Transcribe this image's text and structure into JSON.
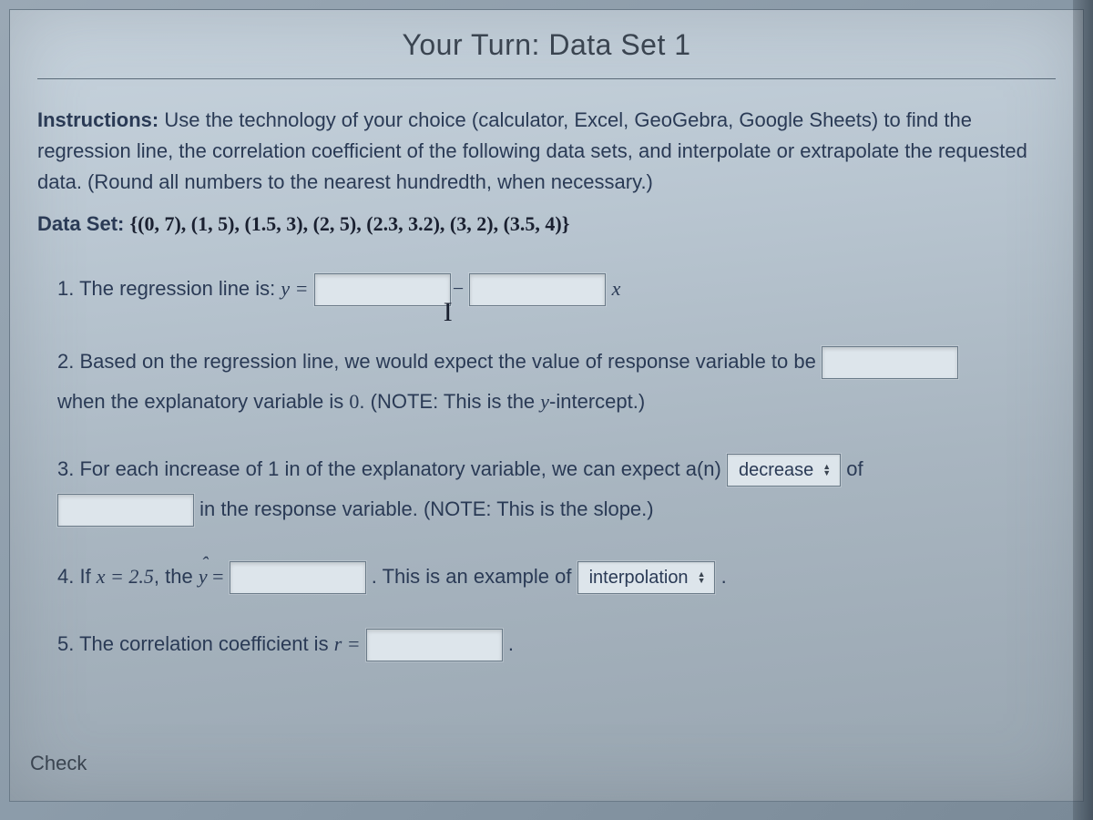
{
  "title": "Your Turn: Data Set 1",
  "instructions": {
    "label": "Instructions:",
    "text": " Use the technology of your choice (calculator, Excel, GeoGebra, Google Sheets) to find the regression line, the correlation coefficient of the following data sets, and interpolate or extrapolate the requested data. (Round all numbers to the nearest hundredth, when necessary.)"
  },
  "dataset": {
    "label": "Data Set: ",
    "value": "{(0, 7), (1, 5), (1.5, 3), (2, 5), (2.3, 3.2), (3, 2), (3.5, 4)}"
  },
  "q1": {
    "prefix": "1. The regression line is: ",
    "y_eq": "y =",
    "minus": "−",
    "x": "x"
  },
  "q2": {
    "line1": "2. Based on the regression line, we would expect the value of response variable to be ",
    "line2a": "when the explanatory variable is ",
    "zero": "0",
    "line2b": ". (NOTE: This is the ",
    "yint_var": "y",
    "line2c": "-intercept.)"
  },
  "q3": {
    "line1": "3. For each increase of 1 in of the explanatory variable, we can expect a(n) ",
    "select_value": "decrease",
    "of": " of",
    "line2": " in the response variable. (NOTE: This is the slope.)"
  },
  "q4": {
    "prefix": "4. If ",
    "x_eq": "x = 2.5",
    "comma_the": ", the ",
    "yhat_eq": " =",
    "middle": ". This is an example of ",
    "select_value": "interpolation",
    "period": "."
  },
  "q5": {
    "prefix": "5. The correlation coefficient is ",
    "r_eq": "r =",
    "period": "."
  },
  "check_label": "Check"
}
